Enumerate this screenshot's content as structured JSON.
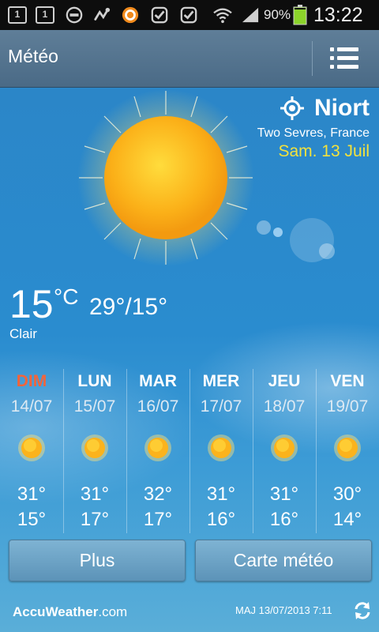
{
  "status_bar": {
    "notification_icons": [
      "sim-1-icon",
      "sim-1-icon",
      "do-not-disturb-icon",
      "usb-icon",
      "avast-icon",
      "checkbox-icon",
      "checkbox-icon"
    ],
    "sim1": "1",
    "sim2": "1",
    "battery_pct": "90%",
    "time": "13:22"
  },
  "header": {
    "title": "Météo",
    "menu_icon": "list-menu-icon"
  },
  "location": {
    "city": "Niort",
    "region": "Two Sevres, France",
    "date": "Sam. 13 Juil",
    "date_color": "#f4e23c",
    "locate_icon": "gps-target-icon"
  },
  "current": {
    "temp": "15",
    "unit": "°C",
    "hi": "29°",
    "sep": "/",
    "lo": "15°",
    "condition": "Clair"
  },
  "forecast": [
    {
      "day": "DIM",
      "date": "14/07",
      "icon": "sun-icon",
      "hi": "31°",
      "lo": "15°",
      "highlight": true
    },
    {
      "day": "LUN",
      "date": "15/07",
      "icon": "sun-icon",
      "hi": "31°",
      "lo": "17°",
      "highlight": false
    },
    {
      "day": "MAR",
      "date": "16/07",
      "icon": "sun-icon",
      "hi": "32°",
      "lo": "17°",
      "highlight": false
    },
    {
      "day": "MER",
      "date": "17/07",
      "icon": "sun-icon",
      "hi": "31°",
      "lo": "16°",
      "highlight": false
    },
    {
      "day": "JEU",
      "date": "18/07",
      "icon": "sun-icon",
      "hi": "31°",
      "lo": "16°",
      "highlight": false
    },
    {
      "day": "VEN",
      "date": "19/07",
      "icon": "sun-icon",
      "hi": "30°",
      "lo": "14°",
      "highlight": false
    }
  ],
  "highlight_color": "#f4643a",
  "buttons": {
    "more": "Plus",
    "map": "Carte météo"
  },
  "footer": {
    "logo_main": "AccuWeather",
    "logo_domain": ".com",
    "updated": "MAJ 13/07/2013 7:11",
    "refresh_icon": "refresh-icon"
  }
}
